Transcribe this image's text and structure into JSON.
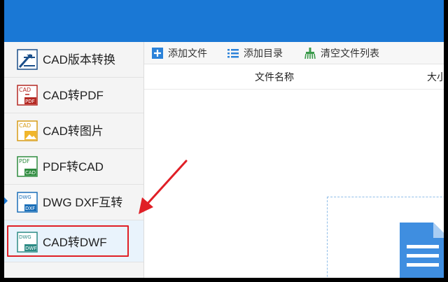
{
  "sidebar": {
    "items": [
      {
        "label": "CAD版本转换",
        "icon": "version-convert-icon"
      },
      {
        "label": "CAD转PDF",
        "icon": "cad-to-pdf-icon"
      },
      {
        "label": "CAD转图片",
        "icon": "cad-to-image-icon"
      },
      {
        "label": "PDF转CAD",
        "icon": "pdf-to-cad-icon"
      },
      {
        "label": "DWG DXF互转",
        "icon": "dwg-dxf-icon"
      },
      {
        "label": "CAD转DWF",
        "icon": "cad-to-dwf-icon",
        "active": true
      }
    ],
    "icon_text": {
      "cad": "CAD",
      "pdf": "PDF",
      "dwg": "DWG",
      "dxf": "DXF",
      "dwf": "DWF"
    }
  },
  "toolbar": {
    "add_file": "添加文件",
    "add_folder": "添加目录",
    "clear_list": "清空文件列表"
  },
  "table": {
    "col_filename": "文件名称",
    "col_size": "大小"
  },
  "colors": {
    "titlebar": "#1a78d5",
    "highlight": "#e01f26",
    "arrow": "#e01f26"
  }
}
